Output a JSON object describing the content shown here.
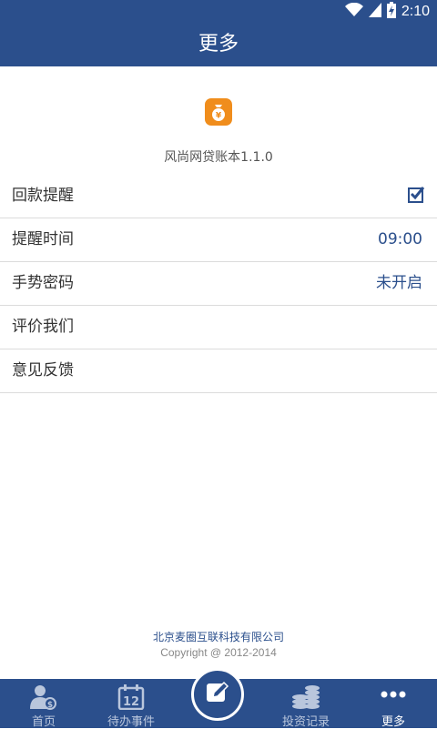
{
  "status_bar": {
    "time": "2:10",
    "icons": [
      "wifi-icon",
      "signal-icon",
      "battery-charging-icon"
    ]
  },
  "header": {
    "title": "更多"
  },
  "app": {
    "icon": "money-bag-icon",
    "name_version": "风尚网贷账本1.1.0"
  },
  "settings": [
    {
      "label": "回款提醒",
      "type": "checkbox",
      "checked": true
    },
    {
      "label": "提醒时间",
      "type": "value",
      "value": "09:00"
    },
    {
      "label": "手势密码",
      "type": "value",
      "value": "未开启"
    },
    {
      "label": "评价我们",
      "type": "link"
    },
    {
      "label": "意见反馈",
      "type": "link"
    }
  ],
  "footer": {
    "company": "北京麦圈互联科技有限公司",
    "copyright": "Copyright @ 2012-2014"
  },
  "tabbar": {
    "tabs": [
      {
        "label": "首页",
        "icon": "user-money-icon",
        "active": false
      },
      {
        "label": "待办事件",
        "icon": "calendar-icon",
        "calendar_day": "12",
        "active": false
      },
      {
        "label": "",
        "icon": "edit-icon",
        "active": false
      },
      {
        "label": "投资记录",
        "icon": "coins-icon",
        "active": false
      },
      {
        "label": "更多",
        "icon": "more-icon",
        "active": true
      }
    ]
  },
  "colors": {
    "primary": "#2b4f8c",
    "app_icon": "#f08d1c",
    "divider": "#dcdcdc"
  }
}
